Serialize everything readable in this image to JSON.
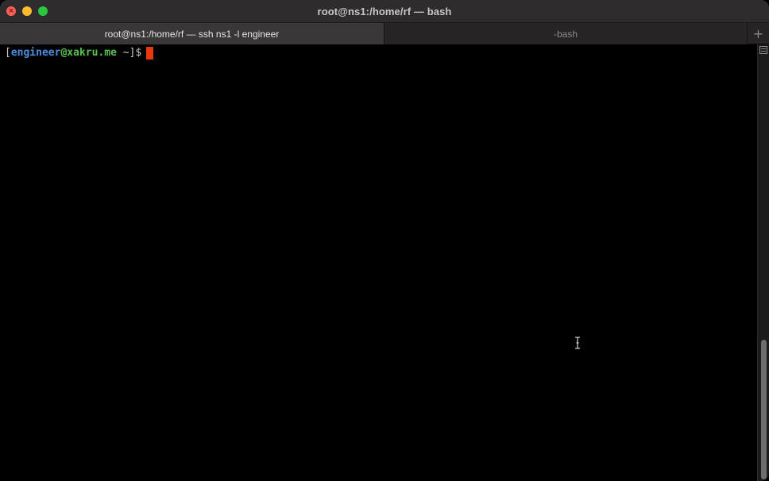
{
  "window": {
    "title": "root@ns1:/home/rf — bash"
  },
  "tabs": [
    {
      "label": "root@ns1:/home/rf — ssh ns1 -l engineer",
      "active": true
    },
    {
      "label": "-bash",
      "active": false
    }
  ],
  "tab_add_label": "+",
  "terminal": {
    "prompt": {
      "open_bracket": "[",
      "user": "engineer",
      "at": "@",
      "host": "xakru.me",
      "path": " ~",
      "close_and_symbol": "]$"
    }
  },
  "icons": {
    "close": "close-icon",
    "minimize": "minimize-icon",
    "maximize": "maximize-icon",
    "new_tab": "plus-icon",
    "cursor": "text-cursor-icon",
    "scroll": "scrollbar-menu-icon"
  },
  "colors": {
    "traffic_close": "#fe5f57",
    "traffic_minimize": "#febc2e",
    "traffic_maximize": "#28c840",
    "prompt_user": "#4b8fe0",
    "prompt_host": "#59c04f",
    "block_cursor": "#e8380e",
    "background": "#000000"
  }
}
